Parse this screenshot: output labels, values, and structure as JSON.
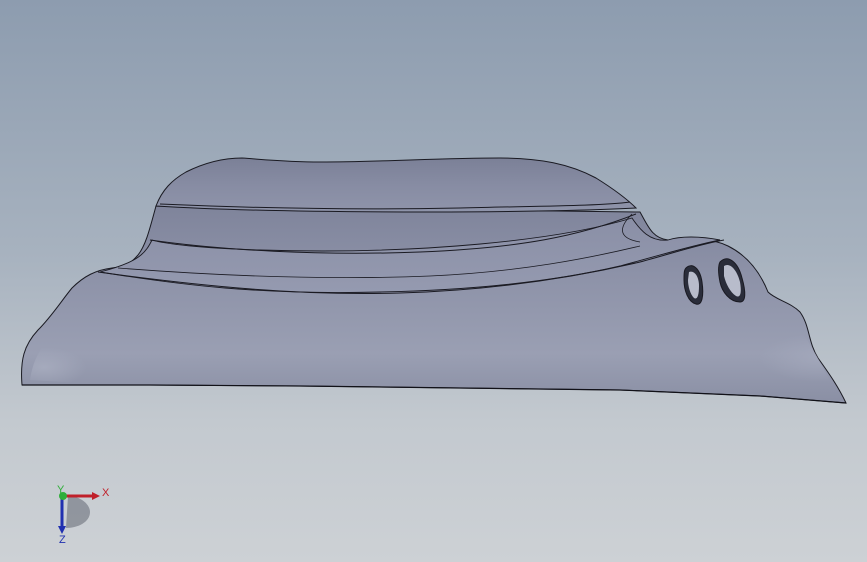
{
  "viewport": {
    "background_top": "#8d9caf",
    "background_bottom": "#cdd1d5"
  },
  "model": {
    "part_color": "#8e93aa",
    "edge_color": "#1a1a22"
  },
  "triad": {
    "x_label": "X",
    "y_label": "Y",
    "z_label": "Z",
    "x_color": "#c0202a",
    "y_color": "#2fae3a",
    "z_color": "#2030b0"
  }
}
